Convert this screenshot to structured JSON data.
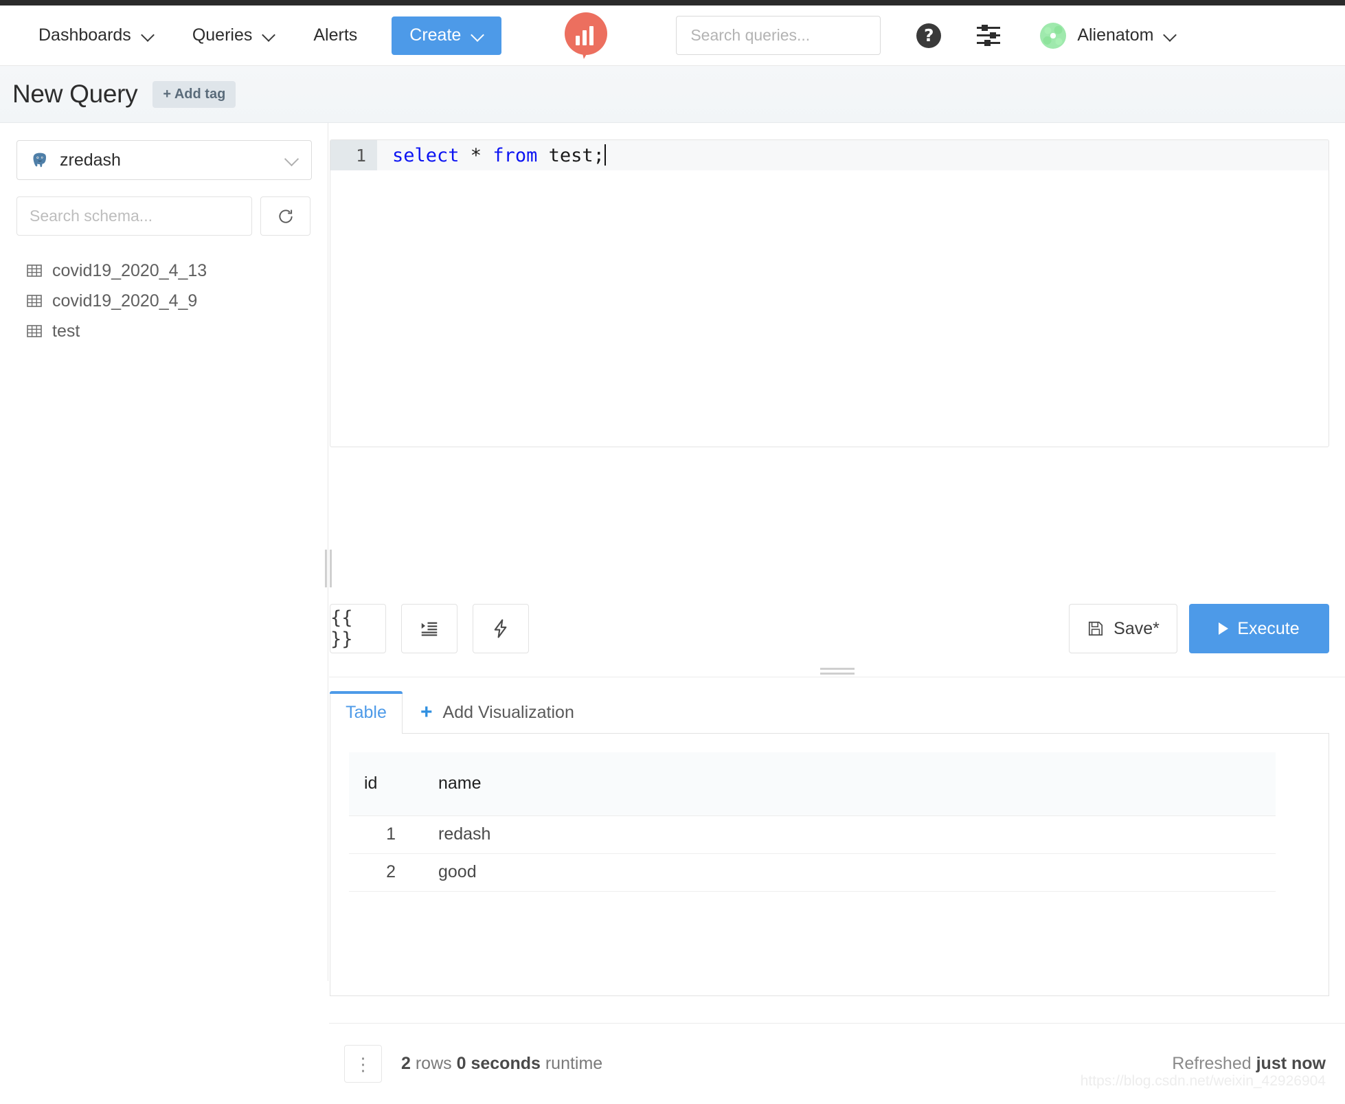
{
  "navbar": {
    "items": [
      {
        "label": "Dashboards",
        "has_caret": true
      },
      {
        "label": "Queries",
        "has_caret": true
      },
      {
        "label": "Alerts",
        "has_caret": false
      }
    ],
    "create_label": "Create",
    "logo_icon": "redash-logo-icon",
    "search": {
      "placeholder": "Search queries...",
      "value": "",
      "icon": "search-icon"
    },
    "help_icon": "help-circle-icon",
    "settings_icon": "sliders-settings-icon",
    "user": {
      "name": "Alienatom",
      "avatar_icon": "user-avatar-identicon"
    },
    "accent_color": "#4d9ae8",
    "logo_color": "#ec6f5f"
  },
  "titlebar": {
    "title": "New Query",
    "add_tag_label": "+ Add tag"
  },
  "sidebar": {
    "datasource": {
      "name": "zredash",
      "icon": "postgresql-elephant-icon",
      "chevron_icon": "chevron-down-icon"
    },
    "schema_search": {
      "placeholder": "Search schema...",
      "value": ""
    },
    "refresh_icon": "refresh-icon",
    "tables": [
      {
        "name": "covid19_2020_4_13",
        "icon": "table-icon"
      },
      {
        "name": "covid19_2020_4_9",
        "icon": "table-icon"
      },
      {
        "name": "test",
        "icon": "table-icon"
      }
    ]
  },
  "editor": {
    "line_number": "1",
    "tokens": [
      {
        "text": "select",
        "type": "keyword"
      },
      {
        "text": " * ",
        "type": "plain"
      },
      {
        "text": "from",
        "type": "keyword"
      },
      {
        "text": " test;",
        "type": "plain"
      }
    ],
    "full_text": "select * from test;",
    "toolbar": [
      {
        "name": "add-parameter-button",
        "label": "{{ }}",
        "icon": "braces-icon"
      },
      {
        "name": "format-query-button",
        "label": "",
        "icon": "format-indent-icon"
      },
      {
        "name": "autocomplete-toggle-button",
        "label": "",
        "icon": "lightning-bolt-icon"
      }
    ],
    "save_label": "Save*",
    "save_icon": "floppy-disk-icon",
    "execute_label": "Execute",
    "execute_icon": "play-icon"
  },
  "results": {
    "tabs": [
      {
        "label": "Table",
        "active": true
      },
      {
        "label": "Add Visualization",
        "active": false,
        "icon": "plus-icon"
      }
    ],
    "table": {
      "columns": [
        "id",
        "name"
      ],
      "rows": [
        {
          "id": "1",
          "name": "redash"
        },
        {
          "id": "2",
          "name": "good"
        }
      ]
    }
  },
  "footer": {
    "menu_icon": "kebab-menu-icon",
    "rows_count": "2",
    "rows_label": "rows",
    "runtime_value": "0 seconds",
    "runtime_label": "runtime",
    "refreshed_prefix": "Refreshed",
    "refreshed_value": "just now",
    "watermark": "https://blog.csdn.net/weixin_42926904"
  }
}
